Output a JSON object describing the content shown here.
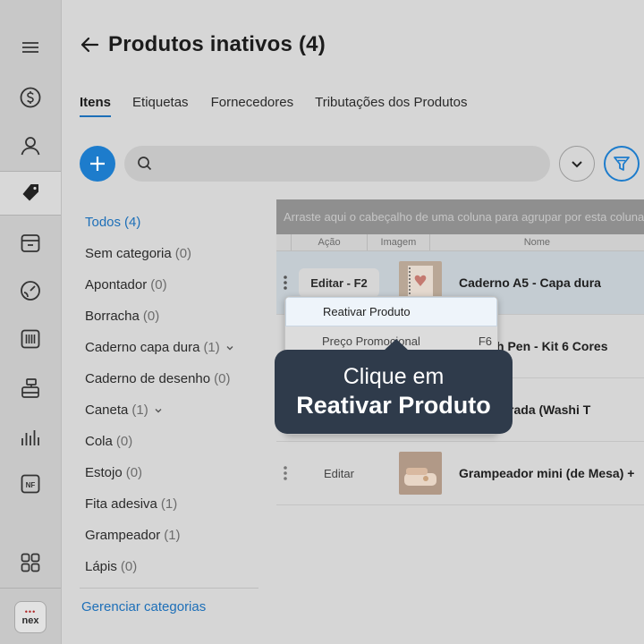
{
  "page": {
    "title": "Produtos inativos (4)"
  },
  "tabs": [
    {
      "label": "Itens"
    },
    {
      "label": "Etiquetas"
    },
    {
      "label": "Fornecedores"
    },
    {
      "label": "Tributações dos Produtos"
    }
  ],
  "search": {
    "value": "",
    "placeholder": ""
  },
  "categories": [
    {
      "label": "Todos",
      "count": "(4)"
    },
    {
      "label": "Sem categoria",
      "count": "(0)"
    },
    {
      "label": "Apontador",
      "count": "(0)"
    },
    {
      "label": "Borracha",
      "count": "(0)"
    },
    {
      "label": "Caderno capa dura",
      "count": "(1)"
    },
    {
      "label": "Caderno de desenho",
      "count": "(0)"
    },
    {
      "label": "Caneta",
      "count": "(1)"
    },
    {
      "label": "Cola",
      "count": "(0)"
    },
    {
      "label": "Estojo",
      "count": "(0)"
    },
    {
      "label": "Fita adesiva",
      "count": "(1)"
    },
    {
      "label": "Grampeador",
      "count": "(1)"
    },
    {
      "label": "Lápis",
      "count": "(0)"
    }
  ],
  "manage_categories": "Gerenciar categorias",
  "grid": {
    "group_hint": "Arraste aqui o cabeçalho de uma coluna para agrupar por esta coluna",
    "columns": {
      "action": "Ação",
      "image": "Imagem",
      "name": "Nome"
    },
    "rows": [
      {
        "edit_label": "Editar - F2",
        "name": "Caderno A5 - Capa dura"
      },
      {
        "edit_label": "",
        "name": "a brush Pen - Kit 6 Cores"
      },
      {
        "edit_label": "",
        "name": "iva decorada (Washi T"
      },
      {
        "edit_label": "Editar",
        "name": "Grampeador mini (de Mesa) +"
      }
    ]
  },
  "context_menu": {
    "items": [
      {
        "label": "Reativar Produto",
        "shortcut": ""
      },
      {
        "label": "Preço Promocional",
        "shortcut": "F6"
      }
    ]
  },
  "tooltip": {
    "line1": "Clique em",
    "line2": "Reativar Produto"
  },
  "logo": {
    "text": "nex"
  },
  "colors": {
    "accent": "#1d7ccc",
    "tooltip_bg": "#2f3b4b"
  }
}
